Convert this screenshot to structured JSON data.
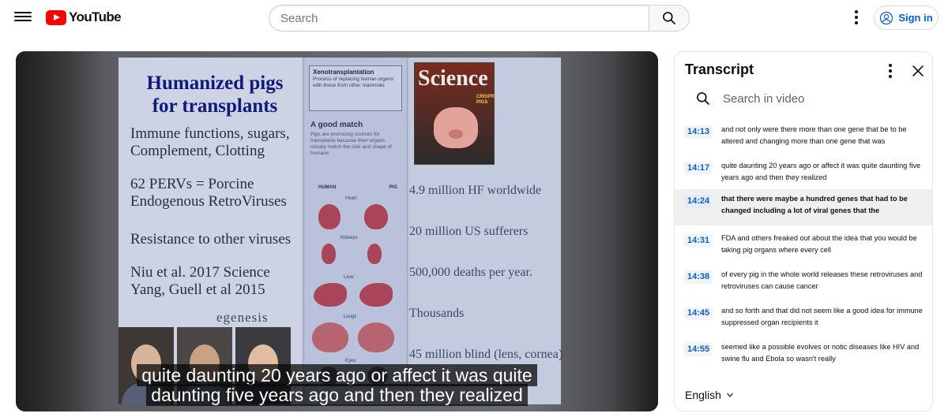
{
  "header": {
    "logo_text": "YouTube",
    "search_placeholder": "Search",
    "signin_label": "Sign in",
    "brand_color": "#ff0000",
    "link_color": "#065fd4"
  },
  "video": {
    "slide": {
      "title_line1": "Humanized pigs",
      "title_line2": "for transplants",
      "left_lines": [
        "Immune functions, sugars,",
        "Complement, Clotting",
        "62 PERVs = Porcine",
        "Endogenous RetroViruses",
        "Resistance to other viruses",
        "Niu et al. 2017 Science",
        "Yang, Guell et al 2015"
      ],
      "egenesis": "egenesis",
      "mid_head": "Xenotransplantation",
      "mid_sub": "Process of replacing human organs with those from other mammals",
      "mid_match": "A good match",
      "mid_desc": "Pigs are promising sources for transplants because their organs closely match the size and shape of humans",
      "mid_col_human": "HUMAN",
      "mid_col_pig": "PIG",
      "organs": [
        "Heart",
        "Kidneys",
        "Liver",
        "Lungs",
        "Eyes"
      ],
      "cover_title": "Science",
      "cover_tag": "CRISPR PIGS",
      "stats": [
        "4.9 million HF worldwide",
        "20 million US sufferers",
        "500,000 deaths per year.",
        "Thousands",
        "45 million blind (lens, cornea)"
      ]
    },
    "caption_line1": "quite daunting 20 years ago or affect it was quite",
    "caption_line2": "daunting five years ago and then they realized"
  },
  "transcript": {
    "title": "Transcript",
    "search_placeholder": "Search in video",
    "language": "English",
    "segments": [
      {
        "time": "14:13",
        "text": "and not only were there more than one gene that be  to be altered and changing more than one gene that was",
        "active": false
      },
      {
        "time": "14:17",
        "text": "quite daunting 20 years ago or affect it was quite daunting five years ago and then they realized",
        "active": false
      },
      {
        "time": "14:24",
        "text": "that there were maybe a hundred genes that had to  be changed including a lot of viral genes that the",
        "active": true
      },
      {
        "time": "14:31",
        "text": "FDA and others freaked out about the idea that  you would be taking pig organs where every cell",
        "active": false
      },
      {
        "time": "14:38",
        "text": "of every pig in the whole world releases these  retroviruses and retroviruses can cause cancer",
        "active": false
      },
      {
        "time": "14:45",
        "text": "and so forth and that did not seem like a good  idea for immune suppressed organ recipients it",
        "active": false
      },
      {
        "time": "14:55",
        "text": "seemed like a possible evolves or notic diseases  like HIV and swine flu and Ebola so wasn't really",
        "active": false
      }
    ]
  }
}
